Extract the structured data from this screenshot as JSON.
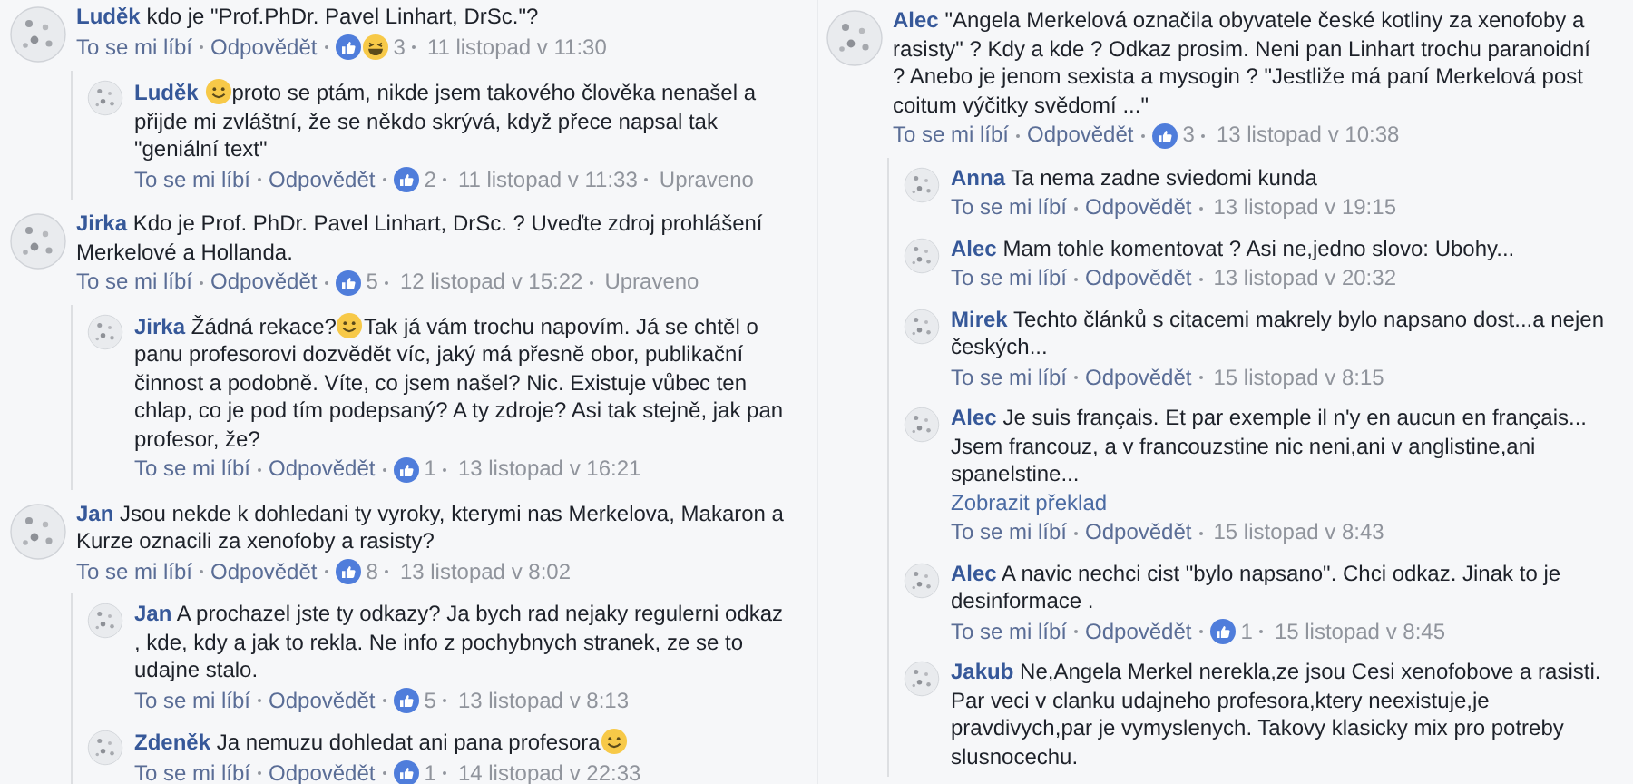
{
  "columns": [
    {
      "comments": [
        {
          "name": "Luděk",
          "parts": [
            {
              "kind": "text",
              "text": "kdo je \"Prof.PhDr. Pavel Linhart, DrSc.\"?"
            }
          ],
          "like": "To se mi líbí",
          "reply": "Odpovědět",
          "reactions": [
            {
              "kind": "like"
            },
            {
              "kind": "haha"
            }
          ],
          "count": "3",
          "time": "11 listopad v 11:30",
          "replies": [
            {
              "name": "Luděk",
              "parts": [
                {
                  "kind": "emoji"
                },
                {
                  "kind": "text",
                  "text": "proto se ptám, nikde jsem takového člověka nenašel a přijde mi zvláštní, že se někdo skrývá, když přece napsal tak \"geniální text\""
                }
              ],
              "like": "To se mi líbí",
              "reply": "Odpovědět",
              "reactions": [
                {
                  "kind": "like"
                }
              ],
              "count": "2",
              "time": "11 listopad v 11:33",
              "edited": "Upraveno"
            }
          ]
        },
        {
          "name": "Jirka",
          "parts": [
            {
              "kind": "text",
              "text": "Kdo je Prof. PhDr. Pavel Linhart, DrSc. ? Uveďte zdroj prohlášení Merkelové a Hollanda."
            }
          ],
          "like": "To se mi líbí",
          "reply": "Odpovědět",
          "reactions": [
            {
              "kind": "like"
            }
          ],
          "count": "5",
          "time": "12 listopad v 15:22",
          "edited": "Upraveno",
          "replies": [
            {
              "name": "Jirka",
              "parts": [
                {
                  "kind": "text",
                  "text": "Žádná rekace?"
                },
                {
                  "kind": "emoji"
                },
                {
                  "kind": "text",
                  "text": "Tak já vám trochu napovím. Já se chtěl o panu profesorovi dozvědět víc, jaký má přesně obor, publikační činnost a podobně. Víte, co jsem našel? Nic. Existuje vůbec ten chlap, co je pod tím podepsaný? A ty zdroje? Asi tak stejně, jak pan profesor, že?"
                }
              ],
              "like": "To se mi líbí",
              "reply": "Odpovědět",
              "reactions": [
                {
                  "kind": "like"
                }
              ],
              "count": "1",
              "time": "13 listopad v 16:21"
            }
          ]
        },
        {
          "name": "Jan",
          "parts": [
            {
              "kind": "text",
              "text": "Jsou nekde k dohledani ty vyroky, kterymi nas Merkelova, Makaron a Kurze oznacili za xenofoby a rasisty?"
            }
          ],
          "like": "To se mi líbí",
          "reply": "Odpovědět",
          "reactions": [
            {
              "kind": "like"
            }
          ],
          "count": "8",
          "time": "13 listopad v 8:02",
          "replies": [
            {
              "name": "Jan",
              "parts": [
                {
                  "kind": "text",
                  "text": "A prochazel jste ty odkazy? Ja bych rad nejaky regulerni odkaz , kde, kdy a jak to rekla. Ne info z pochybnych stranek, ze se to udajne stalo."
                }
              ],
              "like": "To se mi líbí",
              "reply": "Odpovědět",
              "reactions": [
                {
                  "kind": "like"
                }
              ],
              "count": "5",
              "time": "13 listopad v 8:13"
            },
            {
              "name": "Zdeněk",
              "parts": [
                {
                  "kind": "text",
                  "text": "Ja nemuzu dohledat ani pana profesora"
                },
                {
                  "kind": "emoji"
                }
              ],
              "like": "To se mi líbí",
              "reply": "Odpovědět",
              "reactions": [
                {
                  "kind": "like"
                }
              ],
              "count": "1",
              "time": "14 listopad v 22:33"
            }
          ]
        }
      ]
    },
    {
      "comments": [
        {
          "name": "Alec",
          "parts": [
            {
              "kind": "text",
              "text": "\"Angela Merkelová označila obyvatele české kotliny za xenofoby a rasisty\" ? Kdy a kde ? Odkaz prosim. Neni pan Linhart trochu paranoidní ? Anebo je jenom sexista a mysogin ? \"Jestliže má paní Merkelová post coitum výčitky svědomí ...\""
            }
          ],
          "like": "To se mi líbí",
          "reply": "Odpovědět",
          "reactions": [
            {
              "kind": "like"
            }
          ],
          "count": "3",
          "time": "13 listopad v 10:38",
          "replies": [
            {
              "name": "Anna",
              "parts": [
                {
                  "kind": "text",
                  "text": "Ta nema zadne sviedomi kunda"
                }
              ],
              "like": "To se mi líbí",
              "reply": "Odpovědět",
              "time": "13 listopad v 19:15"
            },
            {
              "name": "Alec",
              "parts": [
                {
                  "kind": "text",
                  "text": "Mam tohle komentovat ? Asi ne,jedno slovo: Ubohy..."
                }
              ],
              "like": "To se mi líbí",
              "reply": "Odpovědět",
              "time": "13 listopad v 20:32"
            },
            {
              "name": "Mirek",
              "parts": [
                {
                  "kind": "text",
                  "text": "Techto článků s citacemi makrely bylo napsano dost...a nejen českých..."
                }
              ],
              "like": "To se mi líbí",
              "reply": "Odpovědět",
              "time": "15 listopad v 8:15"
            },
            {
              "name": "Alec",
              "parts": [
                {
                  "kind": "text",
                  "text": "Je suis français. Et par exemple il n'y en aucun en français... Jsem francouz, a v francouzstine nic neni,ani v anglistine,ani spanelstine..."
                }
              ],
              "translate": "Zobrazit překlad",
              "like": "To se mi líbí",
              "reply": "Odpovědět",
              "time": "15 listopad v 8:43"
            },
            {
              "name": "Alec",
              "parts": [
                {
                  "kind": "text",
                  "text": "A navic nechci cist \"bylo napsano\". Chci odkaz. Jinak to je desinformace ."
                }
              ],
              "like": "To se mi líbí",
              "reply": "Odpovědět",
              "reactions": [
                {
                  "kind": "like"
                }
              ],
              "count": "1",
              "time": "15 listopad v 8:45"
            },
            {
              "name": "Jakub",
              "parts": [
                {
                  "kind": "text",
                  "text": "Ne,Angela Merkel nerekla,ze jsou Cesi xenofobove a rasisti. Par veci v clanku udajneho profesora,ktery neexistuje,je pravdivych,par je vymyslenych. Takovy klasicky mix pro potreby slusnocechu."
                }
              ]
            }
          ]
        }
      ]
    }
  ]
}
